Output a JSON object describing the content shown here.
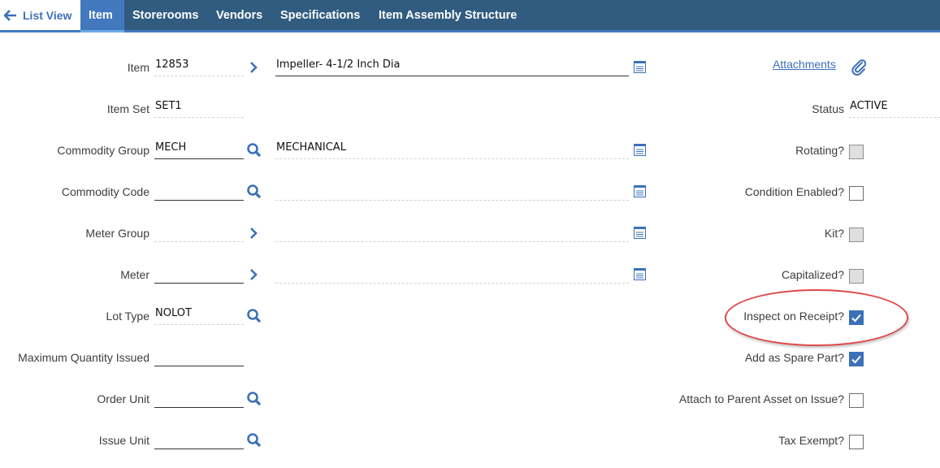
{
  "nav": {
    "back_label": "List View",
    "tabs": [
      {
        "label": "Item",
        "active": true
      },
      {
        "label": "Storerooms",
        "active": false
      },
      {
        "label": "Vendors",
        "active": false
      },
      {
        "label": "Specifications",
        "active": false
      },
      {
        "label": "Item Assembly Structure",
        "active": false
      }
    ]
  },
  "colors": {
    "nav_bg": "#315c80",
    "accent": "#4178be",
    "link": "#3c70b8",
    "highlight": "#e04848"
  },
  "form": {
    "item": {
      "label": "Item",
      "value": "12853",
      "description": "Impeller- 4-1/2 Inch Dia"
    },
    "item_set": {
      "label": "Item Set",
      "value": "SET1"
    },
    "commodity_group": {
      "label": "Commodity Group",
      "value": "MECH",
      "description": "MECHANICAL"
    },
    "commodity_code": {
      "label": "Commodity Code",
      "value": "",
      "description": ""
    },
    "meter_group": {
      "label": "Meter Group",
      "value": "",
      "description": ""
    },
    "meter": {
      "label": "Meter",
      "value": "",
      "description": ""
    },
    "lot_type": {
      "label": "Lot Type",
      "value": "NOLOT"
    },
    "max_qty_issued": {
      "label": "Maximum Quantity Issued",
      "value": ""
    },
    "order_unit": {
      "label": "Order Unit",
      "value": ""
    },
    "issue_unit": {
      "label": "Issue Unit",
      "value": ""
    }
  },
  "right": {
    "attachments_label": "Attachments",
    "status": {
      "label": "Status",
      "value": "ACTIVE"
    },
    "checkboxes": [
      {
        "label": "Rotating?",
        "checked": false,
        "disabled": true
      },
      {
        "label": "Condition Enabled?",
        "checked": false,
        "disabled": false
      },
      {
        "label": "Kit?",
        "checked": false,
        "disabled": true
      },
      {
        "label": "Capitalized?",
        "checked": false,
        "disabled": true
      },
      {
        "label": "Inspect on Receipt?",
        "checked": true,
        "disabled": false,
        "highlighted": true
      },
      {
        "label": "Add as Spare Part?",
        "checked": true,
        "disabled": false
      },
      {
        "label": "Attach to Parent Asset on Issue?",
        "checked": false,
        "disabled": false
      },
      {
        "label": "Tax Exempt?",
        "checked": false,
        "disabled": false
      }
    ]
  }
}
